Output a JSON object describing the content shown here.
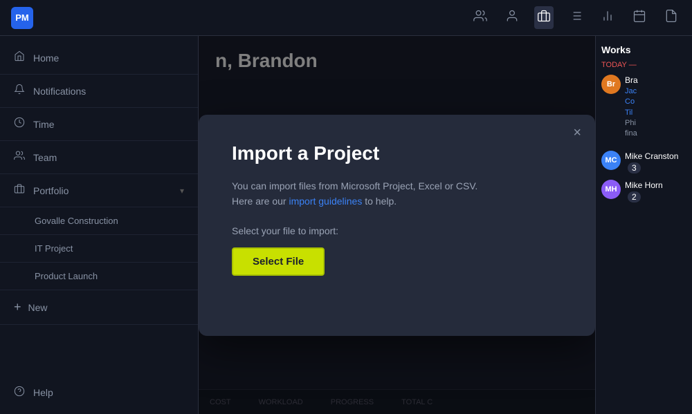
{
  "app": {
    "logo": "PM",
    "title": "Import a Project"
  },
  "topnav": {
    "icons": [
      "👥",
      "👤",
      "📋",
      "≡",
      "📊",
      "📅",
      "📄"
    ]
  },
  "sidebar": {
    "home_label": "Home",
    "notifications_label": "Notifications",
    "time_label": "Time",
    "team_label": "Team",
    "portfolio_label": "Portfolio",
    "portfolio_items": [
      {
        "label": "Govalle Construction"
      },
      {
        "label": "IT Project"
      },
      {
        "label": "Product Launch"
      }
    ],
    "new_label": "New",
    "help_label": "Help"
  },
  "page_header": {
    "text": "n, Brandon"
  },
  "modal": {
    "title": "Import a Project",
    "description_part1": "You can import files from Microsoft Project, Excel or CSV.\nHere are our ",
    "link_text": "import guidelines",
    "description_part2": " to help.",
    "file_label": "Select your file to import:",
    "select_button": "Select File",
    "close_label": "×"
  },
  "right_panel": {
    "title": "Works",
    "today_label": "TODAY —",
    "users": [
      {
        "initials": "Br",
        "bg": "#e07820",
        "name": "Bra",
        "tasks": [
          "Jac",
          "Co",
          "Til"
        ],
        "note": "Phi\nfina"
      }
    ],
    "bottom_users": [
      {
        "initials": "MC",
        "name": "Mike Cranston",
        "count": "3",
        "bg": "#3b82f6"
      },
      {
        "initials": "MH",
        "name": "Mike Horn",
        "count": "2",
        "bg": "#8b5cf6"
      }
    ]
  },
  "table_footer": {
    "cols": [
      "COST",
      "WORKLOAD",
      "PROGRESS",
      "TOTAL C"
    ]
  }
}
